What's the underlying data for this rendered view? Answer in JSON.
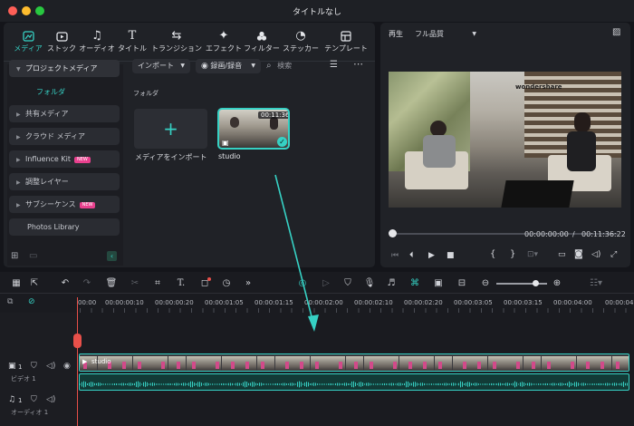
{
  "window": {
    "title": "タイトルなし"
  },
  "tabs": [
    {
      "label": "メディア",
      "icon": "media-icon",
      "active": true
    },
    {
      "label": "ストック",
      "icon": "stock-icon"
    },
    {
      "label": "オーディオ",
      "icon": "audio-note-icon"
    },
    {
      "label": "タイトル",
      "icon": "title-t-icon"
    },
    {
      "label": "トランジション",
      "icon": "transition-icon"
    },
    {
      "label": "エフェクト",
      "icon": "effect-star-icon"
    },
    {
      "label": "フィルター",
      "icon": "filter-icon"
    },
    {
      "label": "ステッカー",
      "icon": "sticker-icon"
    },
    {
      "label": "テンプレート",
      "icon": "template-icon"
    }
  ],
  "sidebar": {
    "project_media": "プロジェクトメディア",
    "folder": "フォルダ",
    "items": [
      {
        "label": "共有メディア",
        "badge": ""
      },
      {
        "label": "クラウド メディア",
        "badge": ""
      },
      {
        "label": "Influence Kit",
        "badge": "NEW"
      },
      {
        "label": "調整レイヤー",
        "badge": ""
      },
      {
        "label": "サブシーケンス",
        "badge": "NEW"
      },
      {
        "label": "Photos Library",
        "badge": ""
      }
    ]
  },
  "toolbar": {
    "import": "インポート",
    "record": "録画/録音",
    "search_placeholder": "検索"
  },
  "library": {
    "section": "フォルダ",
    "import_tile": "メディアをインポート",
    "clip": {
      "name": "studio",
      "duration": "00:11:36"
    }
  },
  "viewer": {
    "play_label": "再生",
    "quality": "フル品質",
    "current_time": "00:00:00:00",
    "separator": "/",
    "total_time": "00:11:36:22",
    "watermark": "wondershare"
  },
  "timeline": {
    "ruler": [
      "00:00",
      "00:00:00:10",
      "00:00:00:20",
      "00:00:01:05",
      "00:00:01:15",
      "00:00:02:00",
      "00:00:02:10",
      "00:00:02:20",
      "00:00:03:05",
      "00:00:03:15",
      "00:00:04:00",
      "00:00:04"
    ],
    "video_track": {
      "number": "1",
      "label": "ビデオ 1",
      "clip": "studio"
    },
    "audio_track": {
      "number": "1",
      "label": "オーディオ 1"
    }
  },
  "colors": {
    "accent": "#36d1c4",
    "playhead": "#e8504a",
    "new_badge": "#e8408e"
  }
}
